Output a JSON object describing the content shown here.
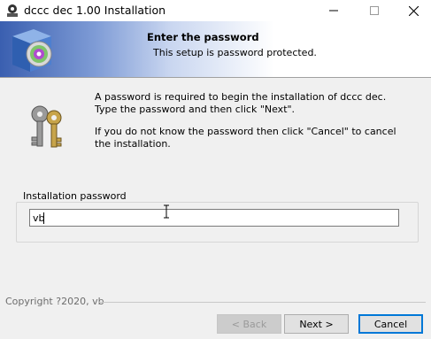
{
  "window": {
    "title": "dccc dec 1.00 Installation",
    "app_icon": "setup-app-icon",
    "controls": {
      "minimize": "minimize-icon",
      "maximize": "maximize-icon",
      "close": "close-icon"
    }
  },
  "header": {
    "title": "Enter the password",
    "subtitle": "This setup is password protected.",
    "image": "setup-disc-box-icon"
  },
  "body": {
    "icon": "keys-icon",
    "message_1": "A password is required to begin the installation of dccc dec. Type the password and then click \"Next\".",
    "message_2": "If you do not know the password then click \"Cancel\" to cancel the installation.",
    "group_label": "Installation password",
    "password_value": "vb"
  },
  "footer": {
    "copyright": "Copyright ?2020, vb",
    "back_label": "< Back",
    "next_label": "Next >",
    "cancel_label": "Cancel",
    "back_enabled": false,
    "default_button": "cancel"
  },
  "colors": {
    "header_gradient_start": "#3a5fb0",
    "focus_border": "#0078d7",
    "dialog_background": "#f0f0f0"
  }
}
